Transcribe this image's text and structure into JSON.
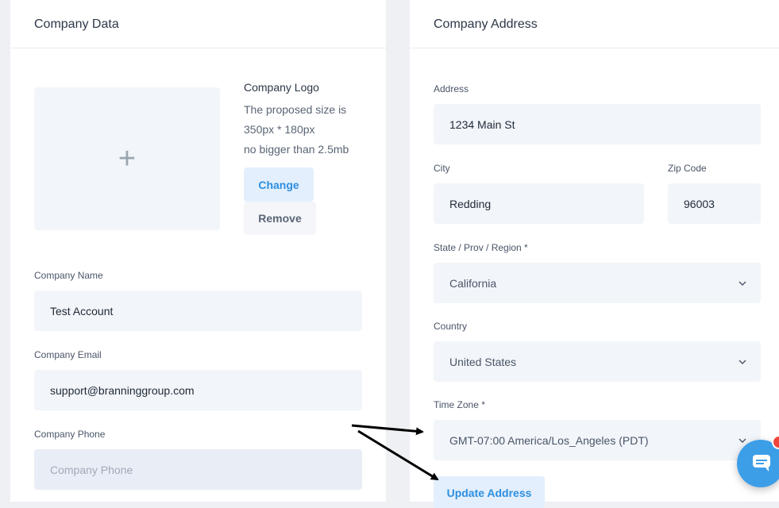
{
  "company_data": {
    "title": "Company Data",
    "logo": {
      "title": "Company Logo",
      "size_line1": "The proposed size is",
      "size_line2": "350px * 180px",
      "size_line3": "no bigger than 2.5mb",
      "change_label": "Change",
      "remove_label": "Remove",
      "placeholder_icon": "plus-icon"
    },
    "name": {
      "label": "Company Name",
      "value": "Test Account"
    },
    "email": {
      "label": "Company Email",
      "value": "support@branninggroup.com"
    },
    "phone": {
      "label": "Company Phone",
      "placeholder": "Company Phone"
    }
  },
  "company_address": {
    "title": "Company Address",
    "address": {
      "label": "Address",
      "value": "1234 Main St"
    },
    "city": {
      "label": "City",
      "value": "Redding"
    },
    "zip": {
      "label": "Zip Code",
      "value": "96003"
    },
    "state": {
      "label": "State / Prov / Region *",
      "value": "California"
    },
    "country": {
      "label": "Country",
      "value": "United States"
    },
    "timezone": {
      "label": "Time Zone *",
      "value": "GMT-07:00 America/Los_Angeles (PDT)"
    },
    "update_label": "Update Address"
  },
  "colors": {
    "accent": "#2d8fe0",
    "button_bg": "#e3effd",
    "field_bg": "#f2f5f9",
    "chat_bg": "#3d9ee8",
    "badge": "#f0453a"
  },
  "icons": [
    "plus-icon",
    "chevron-down-icon",
    "chat-icon",
    "arrow-icon"
  ]
}
